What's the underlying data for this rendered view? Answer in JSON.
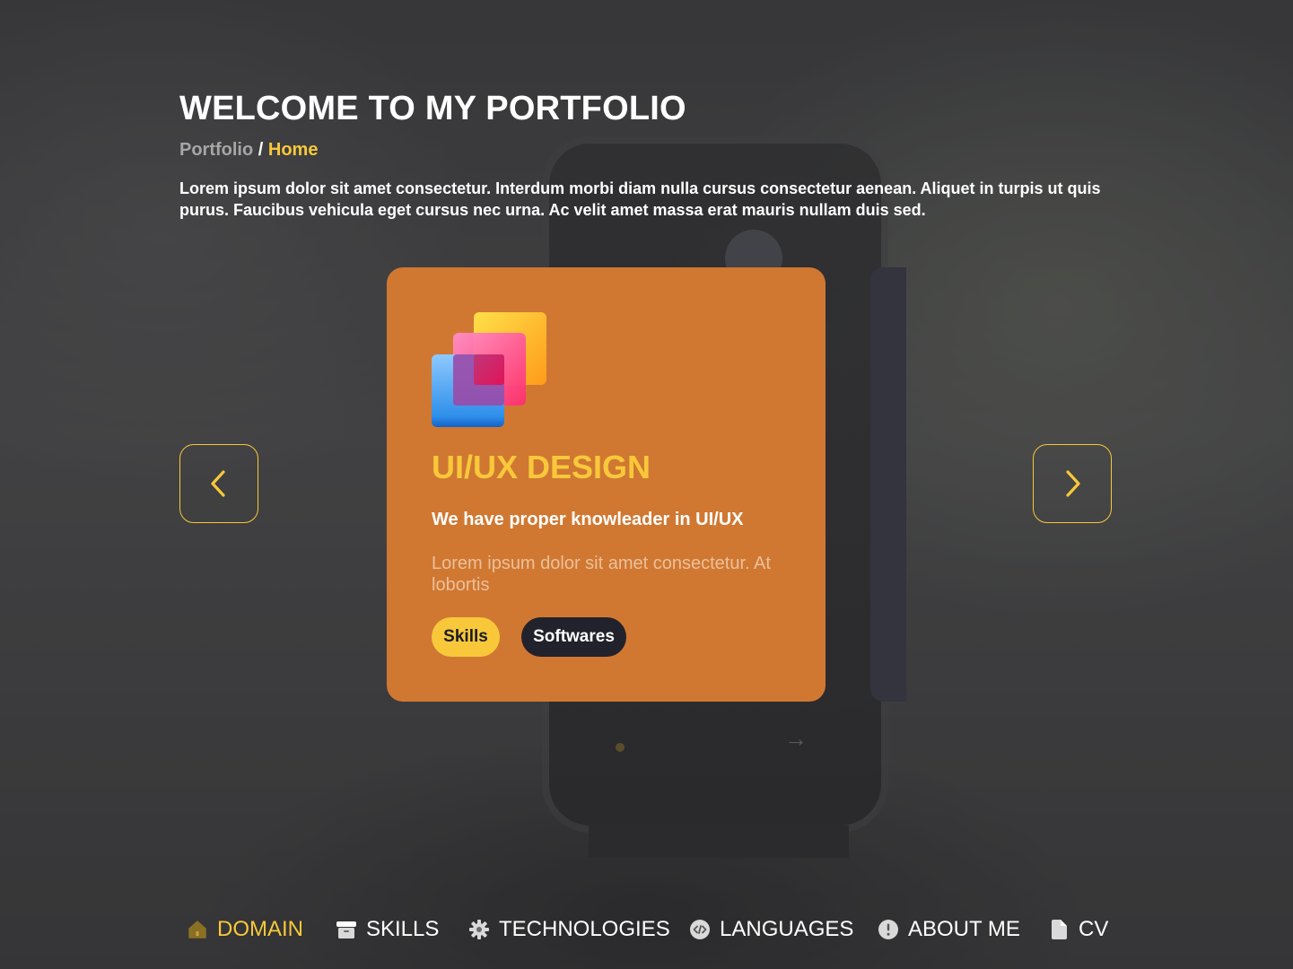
{
  "header": {
    "title": "WELCOME TO MY PORTFOLIO",
    "breadcrumb": {
      "parent": "Portfolio",
      "separator": " / ",
      "current": "Home"
    },
    "intro": "Lorem ipsum dolor sit amet consectetur. Interdum morbi diam nulla cursus consectetur aenean. Aliquet in turpis ut quis purus. Faucibus vehicula eget cursus nec urna. Ac velit amet massa erat mauris nullam duis sed."
  },
  "card": {
    "icon": "layers-gradient-icon",
    "title": "UI/UX DESIGN",
    "subtitle": "We have proper knowleader in UI/UX",
    "description": "Lorem ipsum dolor sit amet consectetur. At lobortis",
    "tags": [
      "Skills",
      "Softwares"
    ],
    "background_color": "#d07832"
  },
  "carousel": {
    "prev_icon": "chevron-left-icon",
    "next_icon": "chevron-right-icon"
  },
  "nav": {
    "items": [
      {
        "label": "DOMAIN",
        "icon": "home-icon",
        "active": true
      },
      {
        "label": "SKILLS",
        "icon": "archive-icon",
        "active": false
      },
      {
        "label": "TECHNOLOGIES",
        "icon": "gear-icon",
        "active": false
      },
      {
        "label": "LANGUAGES",
        "icon": "code-icon",
        "active": false
      },
      {
        "label": "ABOUT ME",
        "icon": "info-icon",
        "active": false
      },
      {
        "label": "CV",
        "icon": "document-icon",
        "active": false
      }
    ]
  },
  "colors": {
    "accent": "#f8c83a",
    "card": "#d07832",
    "dark_pill": "#22222c",
    "side_card": "#33343e"
  }
}
